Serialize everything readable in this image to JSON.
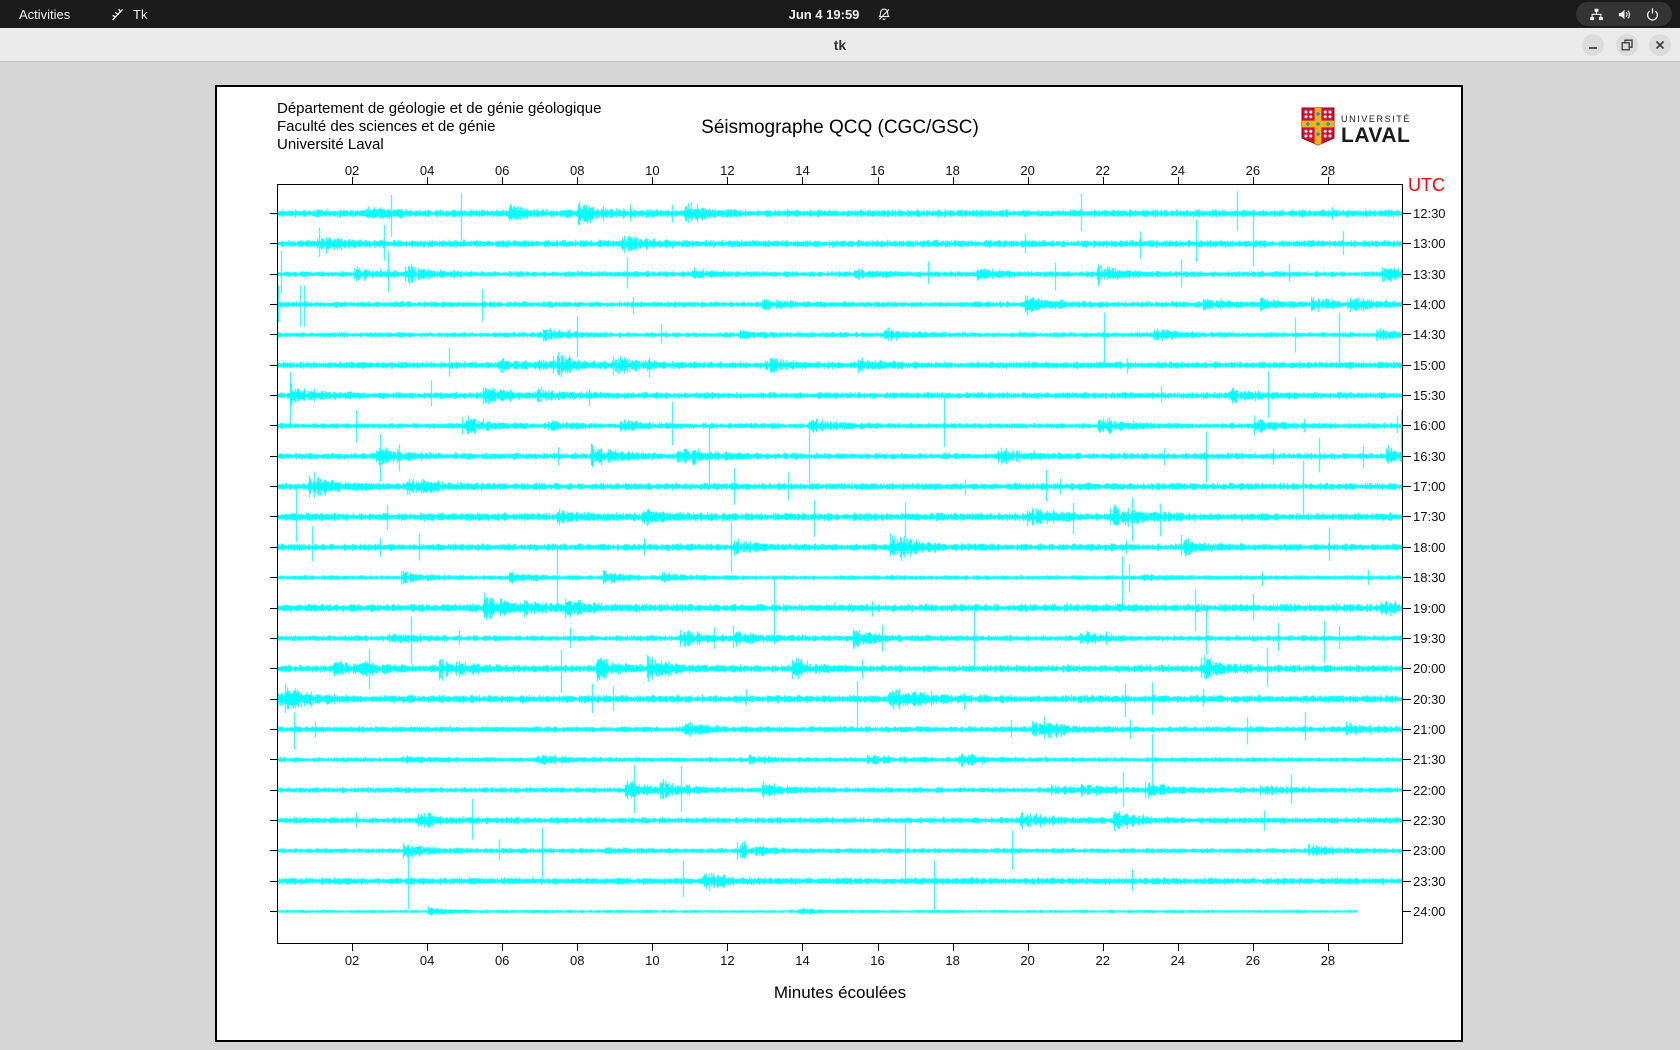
{
  "topbar": {
    "activities_label": "Activities",
    "app_indicator_label": "Tk",
    "clock": "Jun 4 19:59"
  },
  "titlebar": {
    "title": "tk"
  },
  "document": {
    "institution_lines": [
      "Département de géologie et de génie géologique",
      "Faculté des sciences et de génie",
      "Université Laval"
    ],
    "logo": {
      "line1": "UNIVERSITÉ",
      "line2": "LAVAL"
    }
  },
  "chart_data": {
    "type": "seismogram-helicorder",
    "title": "Séismographe QCQ (CGC/GSC)",
    "xlabel": "Minutes écoulées",
    "x_range_minutes": [
      0,
      30
    ],
    "x_tick_labels": [
      "02",
      "04",
      "06",
      "08",
      "10",
      "12",
      "14",
      "16",
      "18",
      "20",
      "22",
      "24",
      "26",
      "28"
    ],
    "right_axis_title": "UTC",
    "row_labels_utc": [
      "12:30",
      "13:00",
      "13:30",
      "14:00",
      "14:30",
      "15:00",
      "15:30",
      "16:00",
      "16:30",
      "17:00",
      "17:30",
      "18:00",
      "18:30",
      "19:00",
      "19:30",
      "20:00",
      "20:30",
      "21:00",
      "21:30",
      "22:00",
      "22:30",
      "23:00",
      "23:30",
      "24:00"
    ],
    "row_interval_minutes": 30,
    "last_row_completion": 0.96,
    "grid": false,
    "legend": null,
    "colors": {
      "trace": "#00ffff",
      "utc_title": "#ff0000",
      "axis": "#000000"
    }
  }
}
